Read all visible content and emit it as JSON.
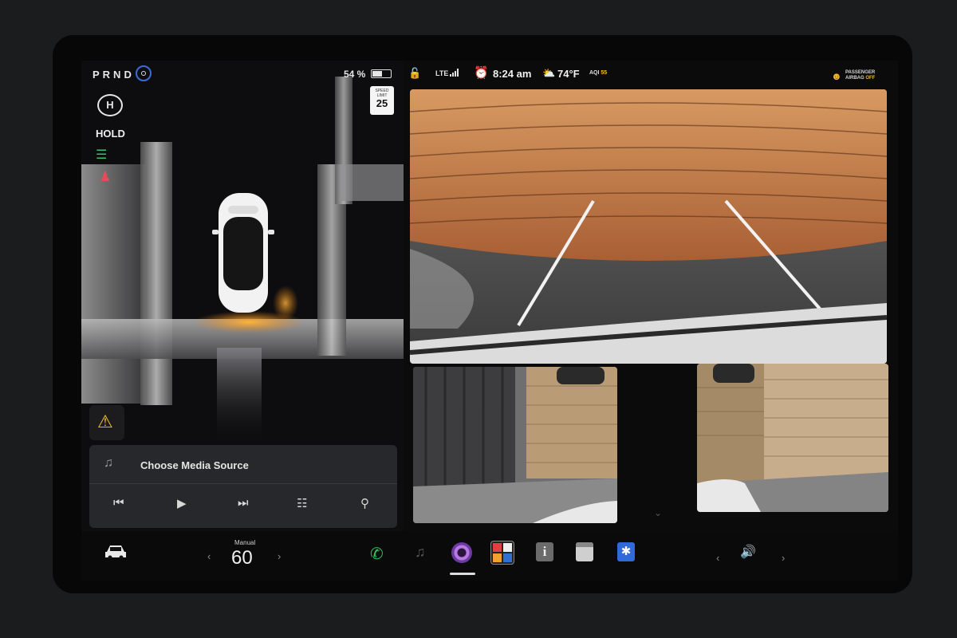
{
  "status": {
    "gear": "PRND",
    "battery_percent": "54 %",
    "battery_level": 0.54,
    "network": "LTE",
    "time": "8:24 am",
    "temperature": "74°F",
    "aqi_label": "AQI",
    "aqi_value": "55",
    "airbag_line1": "PASSENGER",
    "airbag_line2": "AIRBAG",
    "airbag_state": "OFF"
  },
  "speed_limit": {
    "caption_line1": "SPEED",
    "caption_line2": "LIMIT",
    "value": "25"
  },
  "indicators": {
    "hold_icon_letter": "H",
    "hold_label": "HOLD"
  },
  "media": {
    "title": "Choose Media Source"
  },
  "bottom": {
    "speed_mode": "Manual",
    "speed_value": "60"
  },
  "icons": [
    "steering-wheel-icon",
    "battery-icon",
    "hold-icon",
    "headlight-icon",
    "seatbelt-warning-icon",
    "lock-icon",
    "signal-icon",
    "alarm-icon",
    "weather-icon",
    "airbag-icon",
    "warning-icon",
    "music-note-icon",
    "previous-track-icon",
    "play-icon",
    "next-track-icon",
    "equalizer-icon",
    "search-icon",
    "car-icon",
    "phone-icon",
    "camera-app-icon",
    "toybox-icon",
    "info-icon",
    "calendar-icon",
    "bluetooth-icon",
    "volume-icon"
  ],
  "colors": {
    "accent_blue": "#3d6bd6",
    "indicator_green": "#37c46b",
    "warning_red": "#e84a5a",
    "warning_yellow": "#f3c524",
    "alarm_amber": "#f5b52a",
    "phone_green": "#2fc25a",
    "bluetooth_blue": "#2f6ad8"
  }
}
